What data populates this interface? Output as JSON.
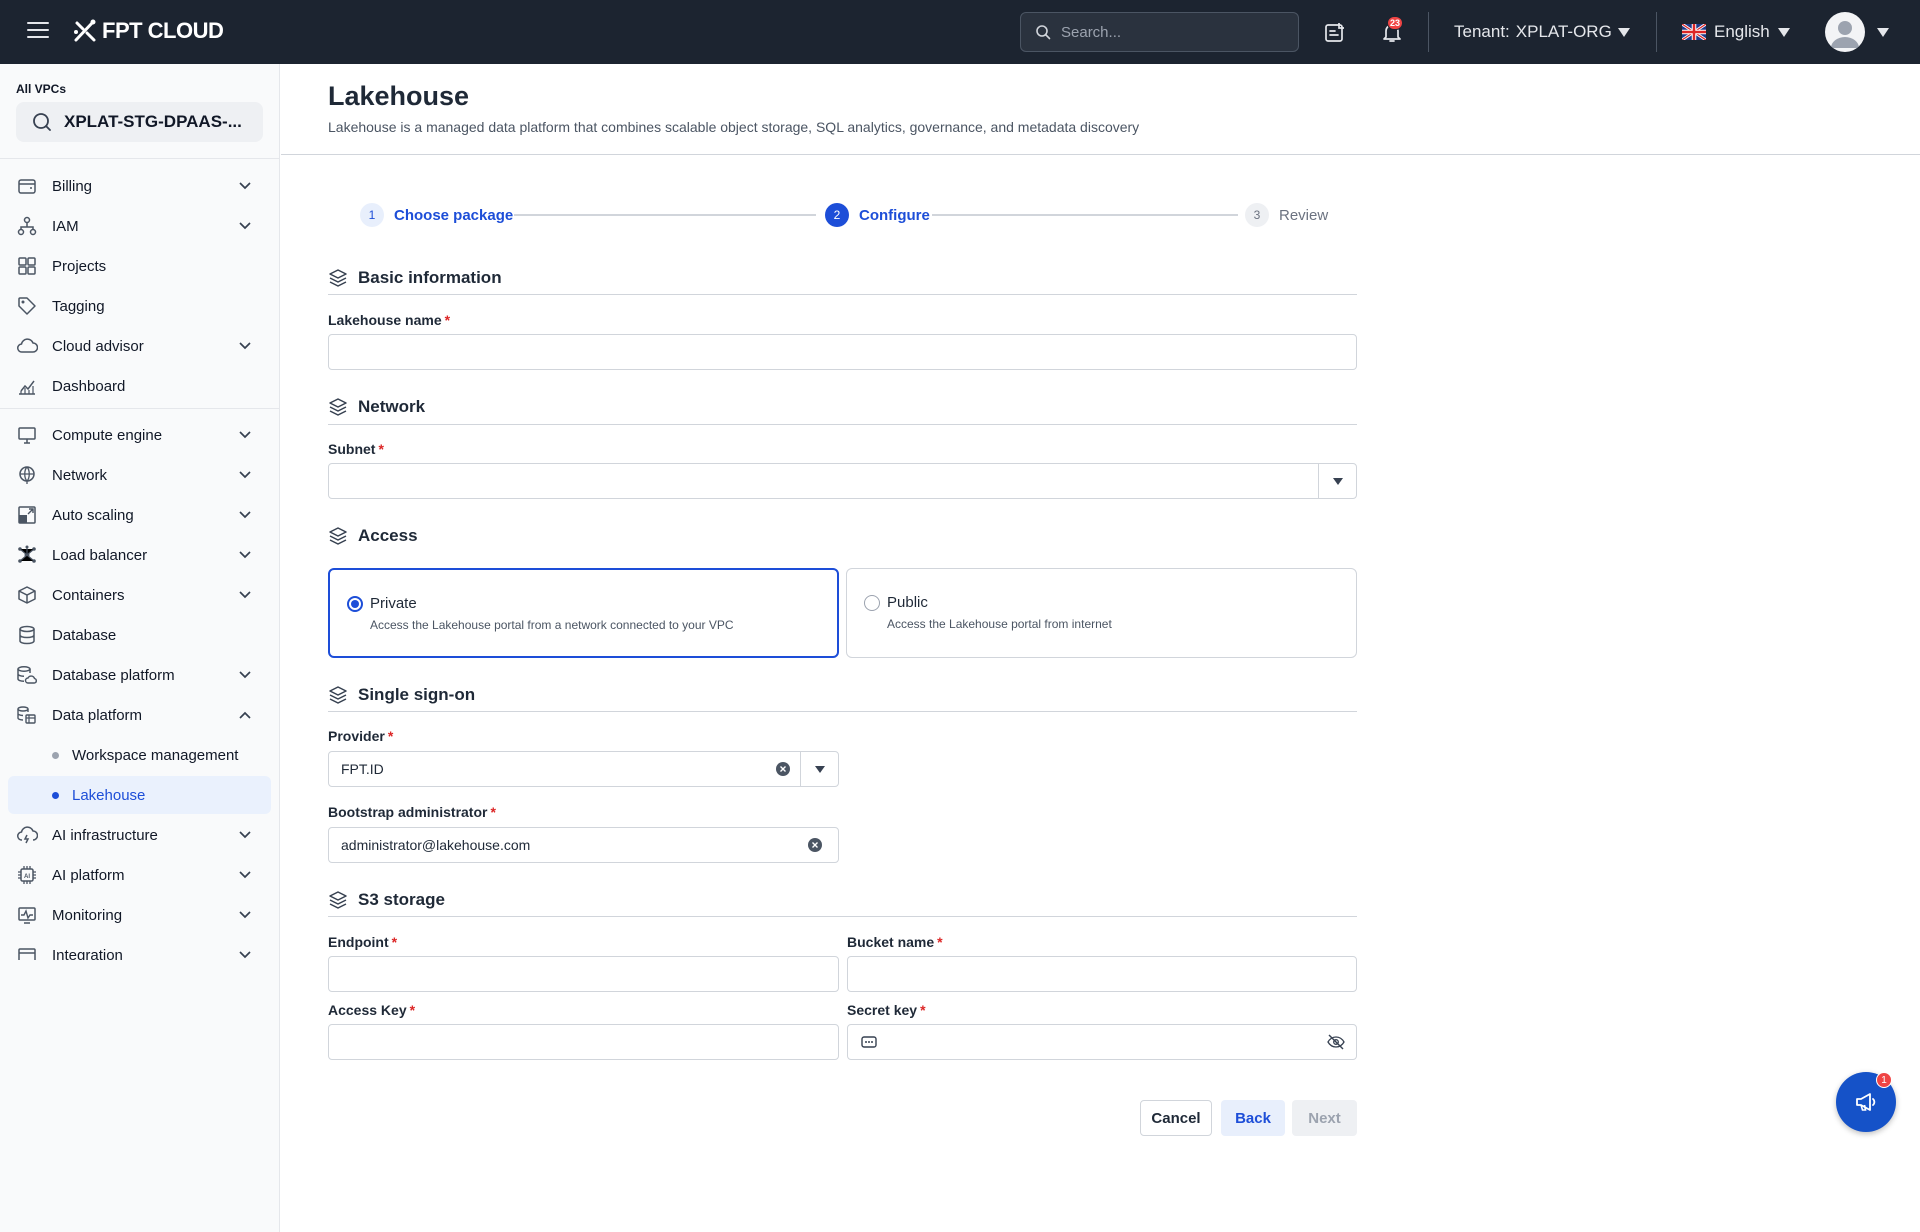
{
  "topbar": {
    "logo": "FPT CLOUD",
    "search_placeholder": "Search...",
    "notifications_count": "23",
    "tenant_label": "Tenant:",
    "tenant_value": "XPLAT-ORG",
    "language": "English"
  },
  "sidebar": {
    "vpc_label": "All VPCs",
    "vpc_value": "XPLAT-STG-DPAAS-...",
    "items": [
      {
        "label": "Billing",
        "icon": "wallet-icon",
        "expandable": true
      },
      {
        "label": "IAM",
        "icon": "hierarchy-icon",
        "expandable": true
      },
      {
        "label": "Projects",
        "icon": "grid-icon",
        "expandable": false
      },
      {
        "label": "Tagging",
        "icon": "tag-icon",
        "expandable": false
      },
      {
        "label": "Cloud advisor",
        "icon": "cloud-icon",
        "expandable": true
      },
      {
        "label": "Dashboard",
        "icon": "chart-icon",
        "expandable": false
      },
      {
        "label": "Compute engine",
        "icon": "monitor-icon",
        "expandable": true
      },
      {
        "label": "Network",
        "icon": "globe-icon",
        "expandable": true
      },
      {
        "label": "Auto scaling",
        "icon": "scaling-icon",
        "expandable": true
      },
      {
        "label": "Load balancer",
        "icon": "nodes-icon",
        "expandable": true
      },
      {
        "label": "Containers",
        "icon": "box-icon",
        "expandable": true
      },
      {
        "label": "Database",
        "icon": "database-icon",
        "expandable": false
      },
      {
        "label": "Database platform",
        "icon": "database-cloud-icon",
        "expandable": true
      },
      {
        "label": "Data platform",
        "icon": "data-platform-icon",
        "expandable": true,
        "expanded": true
      },
      {
        "label": "AI infrastructure",
        "icon": "cloud-bolt-icon",
        "expandable": true
      },
      {
        "label": "AI platform",
        "icon": "ai-chip-icon",
        "expandable": true
      },
      {
        "label": "Monitoring",
        "icon": "pulse-icon",
        "expandable": true
      },
      {
        "label": "Integration",
        "icon": "integration-icon",
        "expandable": true
      }
    ],
    "sub_items": [
      {
        "label": "Workspace management",
        "active": false
      },
      {
        "label": "Lakehouse",
        "active": true
      }
    ]
  },
  "page": {
    "title": "Lakehouse",
    "description": "Lakehouse is a managed data platform that combines scalable object storage, SQL analytics, governance, and metadata discovery"
  },
  "stepper": [
    {
      "num": "1",
      "label": "Choose package",
      "state": "done"
    },
    {
      "num": "2",
      "label": "Configure",
      "state": "active"
    },
    {
      "num": "3",
      "label": "Review",
      "state": "pending"
    }
  ],
  "form": {
    "basic": {
      "title": "Basic information",
      "name_label": "Lakehouse name",
      "name_value": ""
    },
    "network": {
      "title": "Network",
      "subnet_label": "Subnet",
      "subnet_value": ""
    },
    "access": {
      "title": "Access",
      "options": [
        {
          "title": "Private",
          "desc": "Access the Lakehouse portal from a network connected to your VPC",
          "selected": true
        },
        {
          "title": "Public",
          "desc": "Access the Lakehouse portal from internet",
          "selected": false
        }
      ]
    },
    "sso": {
      "title": "Single sign-on",
      "provider_label": "Provider",
      "provider_value": "FPT.ID",
      "admin_label": "Bootstrap administrator",
      "admin_value": "administrator@lakehouse.com"
    },
    "s3": {
      "title": "S3 storage",
      "endpoint_label": "Endpoint",
      "endpoint_value": "",
      "bucket_label": "Bucket name",
      "bucket_value": "",
      "access_key_label": "Access Key",
      "access_key_value": "",
      "secret_key_label": "Secret key",
      "secret_key_value": ""
    }
  },
  "buttons": {
    "cancel": "Cancel",
    "back": "Back",
    "next": "Next"
  },
  "fab_badge": "1",
  "colors": {
    "primary": "#1d4ed8",
    "topbar": "#1c2430",
    "required": "#dc2626"
  }
}
